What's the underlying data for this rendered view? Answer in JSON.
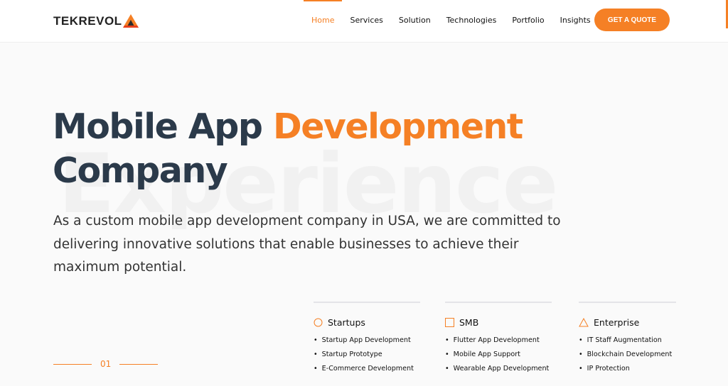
{
  "brand": {
    "name": "TEKREVOL",
    "accent": "#f58025",
    "heading_color": "#2b3a4a"
  },
  "nav": {
    "items": [
      "Home",
      "Services",
      "Solution",
      "Technologies",
      "Portfolio",
      "Insights"
    ],
    "active": "Home",
    "cta": "GET A QUOTE"
  },
  "hero": {
    "title_part1": "Mobile App ",
    "title_highlight": "Development",
    "title_part2": "Company",
    "background_word": "Experience",
    "description": "As a custom mobile app development company in USA, we are committed to delivering innovative solutions that enable businesses to achieve their maximum potential."
  },
  "slider": {
    "index": "01"
  },
  "columns": [
    {
      "title": "Startups",
      "icon": "circle-icon",
      "items": [
        "Startup App Development",
        "Startup Prototype",
        "E-Commerce Development"
      ]
    },
    {
      "title": "SMB",
      "icon": "square-icon",
      "items": [
        "Flutter App Development",
        "Mobile App Support",
        "Wearable App Development"
      ]
    },
    {
      "title": "Enterprise",
      "icon": "triangle-icon",
      "items": [
        "IT Staff Augmentation",
        "Blockchain Development",
        "IP Protection"
      ]
    }
  ]
}
